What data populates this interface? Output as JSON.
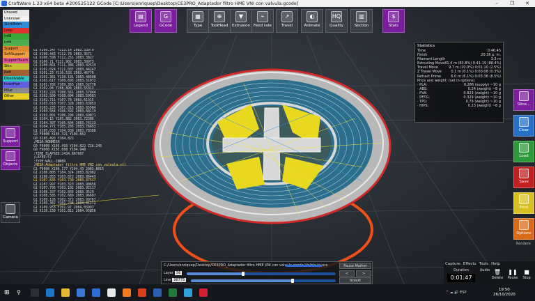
{
  "window": {
    "title": "CraftWare 1.23 x64 beta #200525122   GCode [C:\\Users\\enriquep\\Desktop\\CE3PRO_Adaptador filtro HME VNI con valvula.gcode]",
    "controls": [
      "–",
      "❐",
      "✕"
    ]
  },
  "toolbar": {
    "buttons": [
      {
        "label": "Legend",
        "icon": "legend-icon",
        "glyph": "▤"
      },
      {
        "label": "GCode",
        "icon": "gcode-icon",
        "glyph": "G"
      },
      {
        "label": "Type",
        "icon": "type-icon",
        "glyph": "▦"
      },
      {
        "label": "ToolHead",
        "icon": "toolhead-icon",
        "glyph": "⊕"
      },
      {
        "label": "Extrusion",
        "icon": "extrusion-icon",
        "glyph": "▼"
      },
      {
        "label": "Feed rate",
        "icon": "feed-rate-icon",
        "glyph": "⌁"
      },
      {
        "label": "Travel",
        "icon": "travel-icon",
        "glyph": "↗"
      },
      {
        "label": "Animate",
        "icon": "animate-icon",
        "glyph": "◐"
      },
      {
        "label": "Quality",
        "icon": "quality-icon",
        "glyph": "HQ"
      },
      {
        "label": "Section",
        "icon": "section-icon",
        "glyph": "▥"
      },
      {
        "label": "Stats",
        "icon": "stats-icon",
        "glyph": "$"
      }
    ]
  },
  "filament_legend": [
    {
      "label": "Unused",
      "color": "#e8e8e8"
    },
    {
      "label": "Unknown",
      "color": "#f2f2f2"
    },
    {
      "label": "Skirt/Brim",
      "color": "#2f8bd8"
    },
    {
      "label": "Loop",
      "color": "#e03030"
    },
    {
      "label": "Infill",
      "color": "#38a838"
    },
    {
      "label": "Infill",
      "color": "#50b050"
    },
    {
      "label": "Support",
      "color": "#e08a30"
    },
    {
      "label": "SoftSupport",
      "color": "#f0a040"
    },
    {
      "label": "SupportTouch",
      "color": "#e05a9a"
    },
    {
      "label": "Skin",
      "color": "#c8c030"
    },
    {
      "label": "Raft",
      "color": "#a06030"
    },
    {
      "label": "Dissolvable",
      "color": "#30c0c0"
    },
    {
      "label": "InnerHair",
      "color": "#6060e0"
    },
    {
      "label": "Pillar",
      "color": "#8a8a8a"
    },
    {
      "label": "Other",
      "color": "#e8d020"
    }
  ],
  "gcode_lines": [
    {
      "text": "G1 X100.347 Y113.14 2083.33979",
      "hl": false
    },
    {
      "text": "G1 X100.443 Y112.78 2083.3571",
      "hl": false
    },
    {
      "text": "G1 X100.598 Y112.251 2083.3827",
      "hl": false
    },
    {
      "text": "G1 X100.71 Y111.902 2083.39973",
      "hl": false
    },
    {
      "text": "G1 X100.891 Y111.386 2083.42513",
      "hl": false
    },
    {
      "text": "G1 X101.024 Y111.037 2083.44247",
      "hl": false
    },
    {
      "text": "G1 X101.23 Y110.533 2083.46776",
      "hl": false
    },
    {
      "text": "G1 X101.381 Y110.191 2083.48508",
      "hl": false
    },
    {
      "text": "G1 X101.617 Y109.693 2083.51072",
      "hl": false
    },
    {
      "text": "G1 X101.782 Y109.365 2083.52778",
      "hl": false
    },
    {
      "text": "G1 X102.04 Y108.894 2083.55313",
      "hl": false
    },
    {
      "text": "G1 X102.226 Y108.561 2083.57044",
      "hl": false
    },
    {
      "text": "G1 X102.509 Y108.094 2083.59581",
      "hl": false
    },
    {
      "text": "G1 X102.711 Y107.78 2083.61315",
      "hl": false
    },
    {
      "text": "G1 X103.018 Y107.328 2083.63853",
      "hl": false
    },
    {
      "text": "G1 X103.235 Y107.025 2083.65584",
      "hl": false
    },
    {
      "text": "G1 X103.564 Y106.591 2083.68113",
      "hl": false
    },
    {
      "text": "G1 X103.801 Y106.296 2083.69871",
      "hl": false
    },
    {
      "text": "G1 X104.15 Y105.882 2083.72386",
      "hl": false
    },
    {
      "text": "G1 X104.397 Y105.604 2083.74113",
      "hl": false
    },
    {
      "text": "G1 X104.771 Y105.205 2083.76653",
      "hl": false
    },
    {
      "text": "G1 X105.033 Y104.939 2083.78388",
      "hl": false
    },
    {
      "text": "G0 F9000 X105.321 Y104.662",
      "hl": false
    },
    {
      "text": "G0 X105.493 Y104.822",
      "hl": false
    },
    {
      "text": ";MESH:NONMESH",
      "hl": false
    },
    {
      "text": "G0 F9000 X105.493 Y104.822 Z16.245",
      "hl": false
    },
    {
      "text": "G0 F9000 X105.608 Y104.948",
      "hl": false
    },
    {
      "text": ";TIME_ELAPSED:2434.807607",
      "hl": false
    },
    {
      "text": ";LAYER:57",
      "hl": false
    },
    {
      "text": ";TYPE:WALL-INNER",
      "hl": false
    },
    {
      "text": ";MESH:Adaptador filtro HME VNI con valvula.stl",
      "hl": true
    },
    {
      "text": "G1 F9000 X106.177 Y104.43 2083.8015",
      "hl": false
    },
    {
      "text": "G1 X106.805 Y104.324 2083.82962",
      "hl": false
    },
    {
      "text": "G1 X106.855 Y103.872 2083.86443",
      "hl": false
    },
    {
      "text": "G1 X107.835 Y103.739 2083.87537",
      "hl": true
    },
    {
      "text": "G1 X107.997 Y103.323 2083.90656",
      "hl": false
    },
    {
      "text": "G1 X107.795 Y103.102 2083.92117",
      "hl": false
    },
    {
      "text": "G1 X108.337 Y102.835 2083.9529",
      "hl": false
    },
    {
      "text": "G1 X108.585 Y102.689 2083.96697",
      "hl": false
    },
    {
      "text": "G1 X109.126 Y102.372 2083.99767",
      "hl": false
    },
    {
      "text": "G1 X109.382 Y102.238 2084.01272",
      "hl": false
    },
    {
      "text": "G1 X109.953 Y101.97 2084.03997",
      "hl": false
    },
    {
      "text": "G1 X110.239 Y101.812 2084.05856",
      "hl": false
    }
  ],
  "left_buttons": {
    "support": "Support",
    "objects": "Objects",
    "camera": "Camera"
  },
  "statistics": {
    "title": "Statistics",
    "rows": [
      {
        "label": "Time",
        "value": "0:46:45"
      },
      {
        "label": "Finish",
        "value": "20:36 p. m."
      },
      {
        "label": "Filament Length",
        "value": "3.3 m"
      },
      {
        "label": "Extruding Move",
        "value": "81.4 m (83.8%)  0:41:19 (88.4%)"
      },
      {
        "label": "Travel Move",
        "value": "9.7 m (10.0%)  0:01:10 (2.5%)"
      },
      {
        "label": "Z Travel Move",
        "value": "0.1 m (0.1%)  0:00:08 (0.3%)"
      },
      {
        "label": "Retract Prime",
        "value": "6.0 m (6.1%)  0:03:38 (8.5%)"
      },
      {
        "label": "Price and weight: (set in options)",
        "value": ""
      },
      {
        "label": "· PLA:",
        "value": "0.286 (supply) ~10 g"
      },
      {
        "label": "· ABS:",
        "value": "0.24 (weight) ~8 g"
      },
      {
        "label": "· PVA:",
        "value": "0.823 (weight) ~10 g"
      },
      {
        "label": "· PETG:",
        "value": "0.329 (weight) ~10 g"
      },
      {
        "label": "· TPU:",
        "value": "0.79 (weight) ~10 g"
      },
      {
        "label": "· HIPS:",
        "value": "0.23 (weight) ~8 g"
      }
    ]
  },
  "right_buttons": [
    {
      "label": "Slice...",
      "color": "#7a1e9c"
    },
    {
      "label": "Clear",
      "color": "#2670c8"
    },
    {
      "label": "Load",
      "color": "#2c9a3a"
    },
    {
      "label": "Save",
      "color": "#c02020"
    },
    {
      "label": "Print",
      "color": "#d8c020"
    },
    {
      "label": "Options",
      "color": "#d86a18"
    }
  ],
  "render_label": "Rendere",
  "layer_panel": {
    "file": "C:/Users/enriquep/Desktop/CE3PRO_Adaptador filtro HME VNI con valvula.gcode   Visible layers",
    "pause_marker": "Pause Marker",
    "layer_label": "Layer",
    "layer_value": "56",
    "layer_fraction": 0.38,
    "line_label": "Line",
    "line_value": "98775",
    "line_fraction": 0.7,
    "prev": "<",
    "next": ">",
    "insert": "Insert"
  },
  "capture": {
    "tabs": [
      "Capture",
      "Effects",
      "Tools",
      "Help"
    ],
    "duration_label": "Duration",
    "time": "0:01:47",
    "buttons": [
      {
        "label": "Delete",
        "glyph": "🗑"
      },
      {
        "label": "Pause",
        "glyph": "❚❚"
      },
      {
        "label": "Stop",
        "glyph": "■"
      }
    ],
    "audio": "Audio"
  },
  "taskbar": {
    "start_glyph": "⊞",
    "search_glyph": "⚲",
    "apps": [
      {
        "name": "task-view-icon",
        "color": "#2b2f36"
      },
      {
        "name": "edge-icon",
        "color": "#1f74c8"
      },
      {
        "name": "explorer-icon",
        "color": "#e8b830"
      },
      {
        "name": "store-icon",
        "color": "#3a77d0"
      },
      {
        "name": "mail-icon",
        "color": "#2f6bd6"
      },
      {
        "name": "chrome-icon",
        "color": "#e8e8e8"
      },
      {
        "name": "firefox-icon",
        "color": "#f07a20"
      },
      {
        "name": "craftware-icon",
        "color": "#d84020"
      },
      {
        "name": "word-icon",
        "color": "#2b5db0"
      },
      {
        "name": "excel-icon",
        "color": "#1f7a3c"
      },
      {
        "name": "photos-icon",
        "color": "#30a0d8"
      },
      {
        "name": "recorder-icon",
        "color": "#d02030"
      }
    ],
    "tray": "^  ☁  🔊  ESP",
    "time": "19:50",
    "date": "26/10/2020"
  }
}
